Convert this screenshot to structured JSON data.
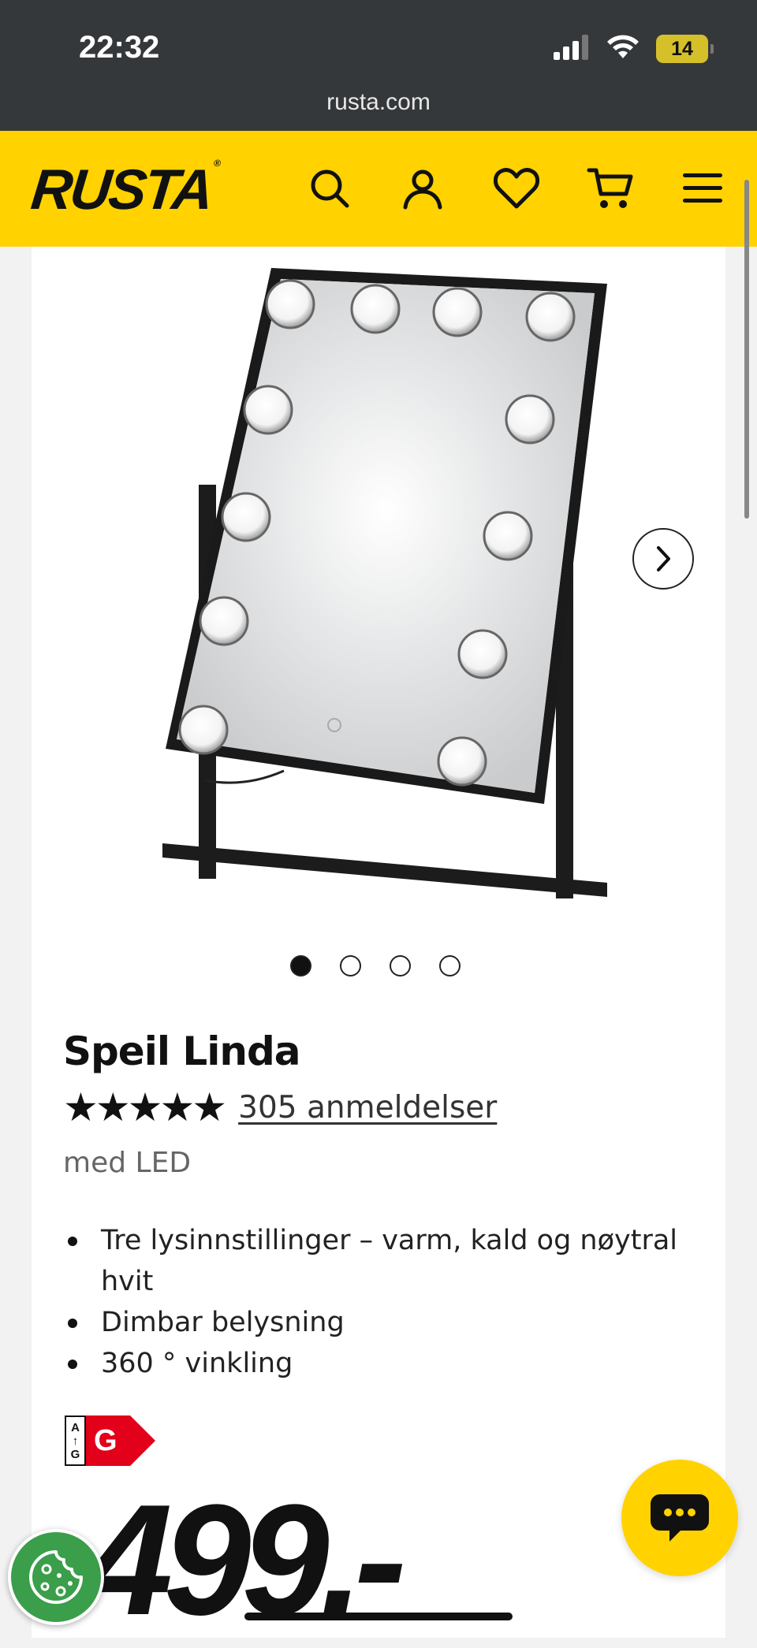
{
  "status_bar": {
    "time": "22:32",
    "battery": "14",
    "icons": [
      "signal-icon",
      "wifi-icon",
      "battery-icon"
    ]
  },
  "browser": {
    "url": "rusta.com"
  },
  "header": {
    "logo": "RUSTA",
    "logo_mark": "®",
    "icons": [
      "search-icon",
      "account-icon",
      "wishlist-heart-icon",
      "cart-icon",
      "menu-icon"
    ],
    "background": "#ffd200"
  },
  "product": {
    "title": "Speil Linda",
    "stars": "★★★★★",
    "rating_value": 5,
    "reviews": "305 anmeldelser",
    "subtitle": "med LED",
    "features": [
      "Tre lysinnstillinger – varm, kald og nøytral hvit",
      "Dimbar belysning",
      "360 ° vinkling"
    ],
    "energy": {
      "scale_top": "A",
      "scale_arrow": "↑",
      "scale_bottom": "G",
      "class": "G",
      "color": "#e2001a"
    },
    "price": "499.-",
    "image_count": 4,
    "active_image": 1
  },
  "floating": {
    "cookie_icon": "cookie-icon",
    "chat_icon": "chat-icon"
  },
  "colors": {
    "brand_yellow": "#ffd200",
    "cookie_green": "#3a9e4a",
    "status_bar": "#35383b"
  }
}
